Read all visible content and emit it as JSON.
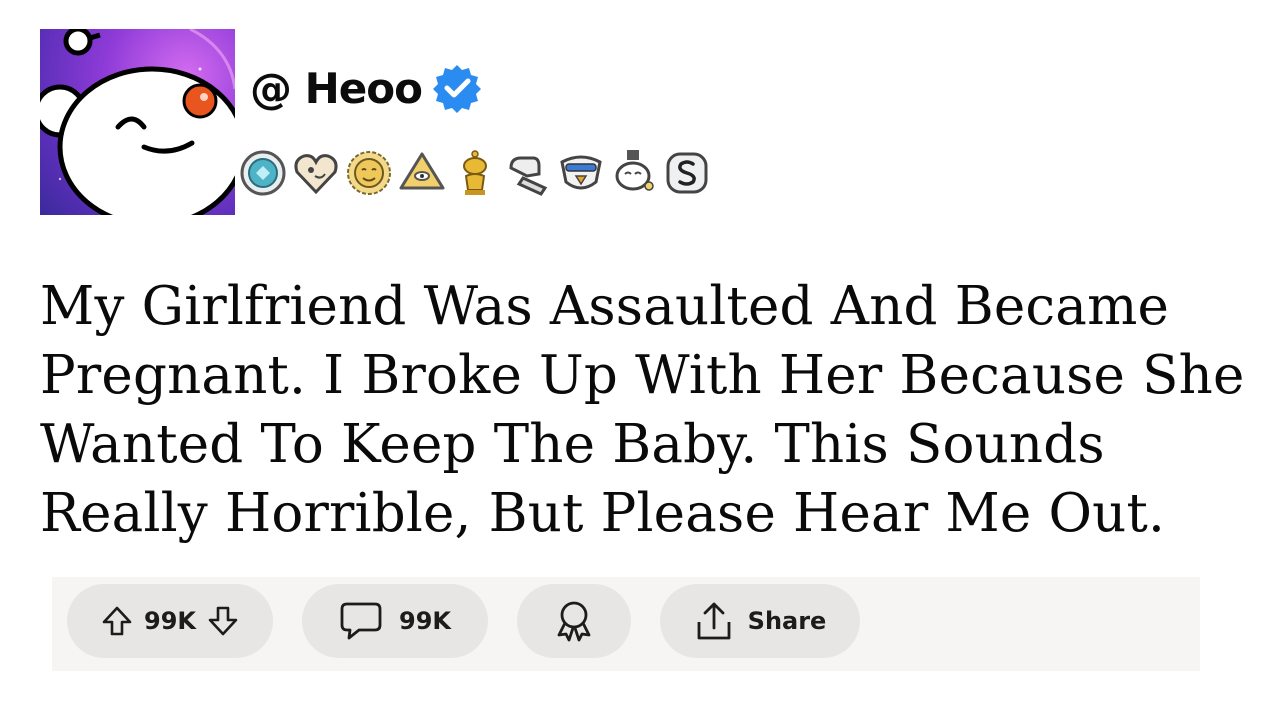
{
  "post": {
    "username": "@ Heoo",
    "verified": true,
    "title": "My Girlfriend Was Assaulted And Became Pregnant. I Broke Up With Her Because She Wanted To Keep The Baby. This Sounds Really Horrible, But Please Hear Me Out."
  },
  "awards": [
    "gem-award-icon",
    "heart-award-icon",
    "sun-award-icon",
    "pyramid-award-icon",
    "gold-snoo-award-icon",
    "fist-award-icon",
    "eagle-award-icon",
    "snoo-face-award-icon",
    "silver-s-award-icon"
  ],
  "actions": {
    "vote_count": "99K",
    "comment_count": "99K",
    "share_label": "Share"
  },
  "colors": {
    "verified_blue": "#2a8cf0",
    "action_bar_bg": "#f6f5f4",
    "pill_bg": "#e8e6e4",
    "avatar_purple": "#8f3bd8"
  }
}
